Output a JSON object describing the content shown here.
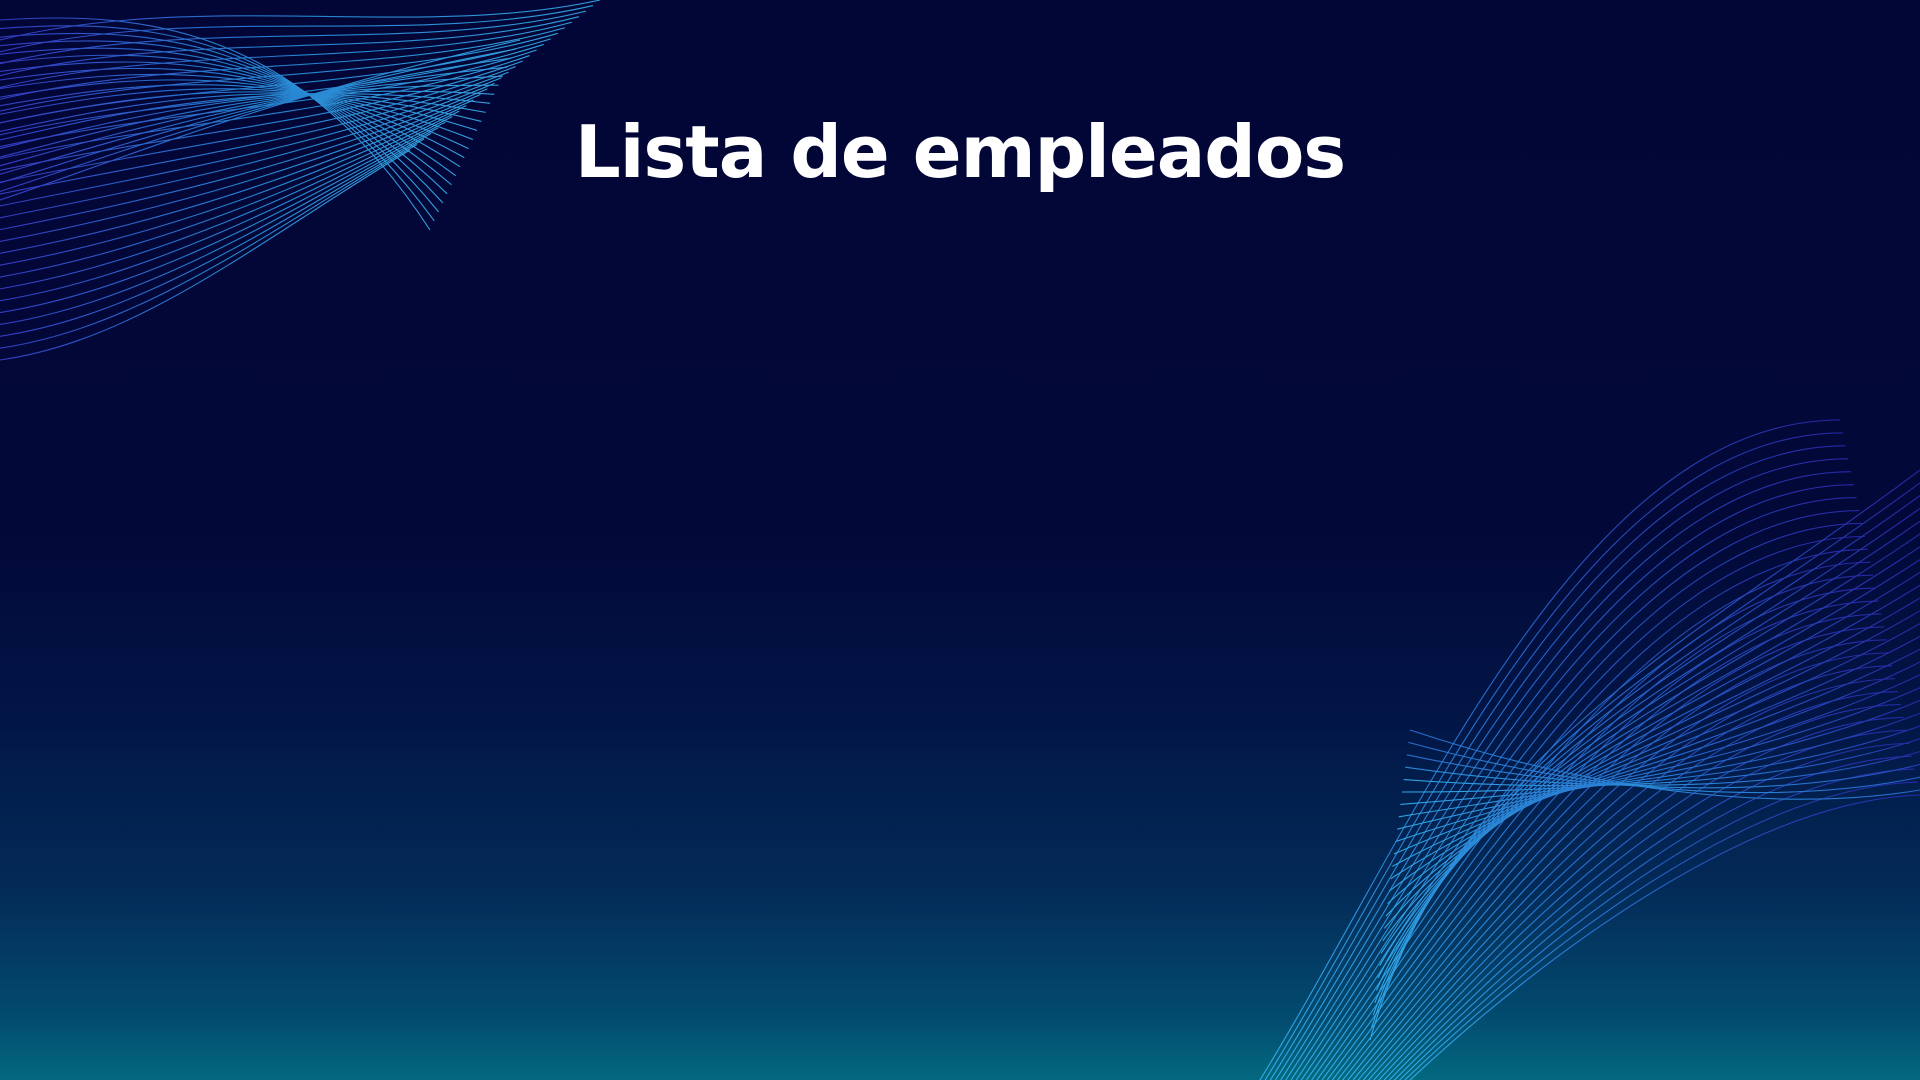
{
  "slide": {
    "title": "Lista de empleados"
  },
  "theme": {
    "background_top": "#020637",
    "background_bottom": "#03697f",
    "wave_color_light": "#2a8fe0",
    "wave_color_dark": "#2530b8",
    "title_color": "#ffffff"
  },
  "decorations": [
    {
      "name": "top-left-wave-mesh"
    },
    {
      "name": "bottom-right-wave-mesh"
    }
  ]
}
